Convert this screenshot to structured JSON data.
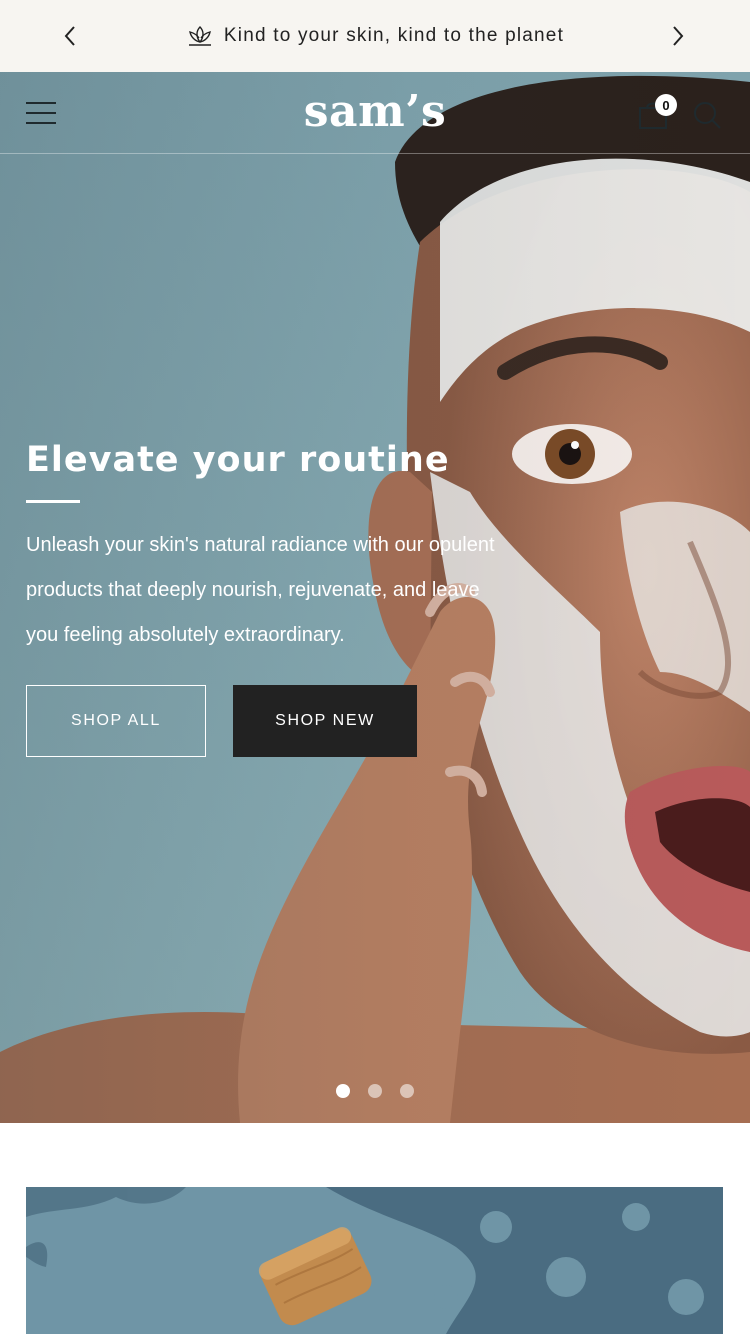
{
  "announcement": {
    "message": "Kind to your skin, kind to the planet",
    "icon": "lotus-leaf-icon"
  },
  "header": {
    "logo": "sam’s",
    "cart_count": "0"
  },
  "hero": {
    "title": "Elevate your routine",
    "description": "Unleash your skin's natural radiance with our opulent products that deeply nourish, rejuvenate, and leave you feeling absolutely extraordinary.",
    "buttons": {
      "shop_all": "SHOP ALL",
      "shop_new": "SHOP NEW"
    },
    "slides_total": 3,
    "active_slide": 1
  },
  "colors": {
    "announcement_bg": "#f7f5f1",
    "hero_bg": "#86a8b1",
    "button_dark": "#222222",
    "banner_bg": "#6f95a6"
  }
}
